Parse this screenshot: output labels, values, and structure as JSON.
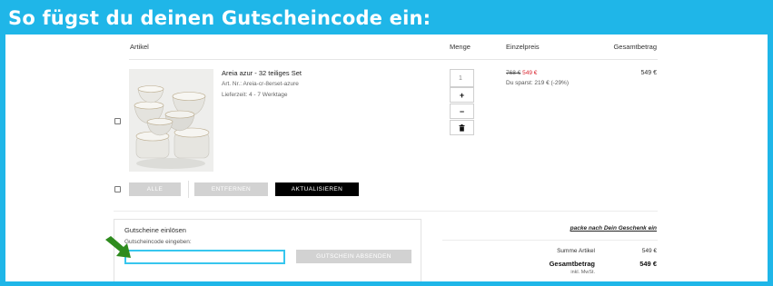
{
  "banner": {
    "title": "So fügst du deinen Gutscheincode ein:"
  },
  "table": {
    "headers": {
      "article": "Artikel",
      "quantity": "Menge",
      "unit_price": "Einzelpreis",
      "total": "Gesamtbetrag"
    }
  },
  "item": {
    "name": "Areia azur - 32 teiliges Set",
    "art_nr": "Art. Nr.: Areia-cr-8erset-azure",
    "delivery": "Lieferzeit: 4 - 7 Werktage",
    "old_price": "768 €",
    "new_price": "549 €",
    "savings": "Du sparst: 219 € (-29%)",
    "quantity": "1",
    "total": "549 €"
  },
  "controls": {
    "plus": "+",
    "minus": "−",
    "trash_icon": "trash-icon"
  },
  "actions": {
    "all": "ALLE",
    "remove": "ENTFERNEN",
    "update": "AKTUALISIEREN"
  },
  "coupon": {
    "title": "Gutscheine einlösen",
    "label": "Gutscheincode eingeben:",
    "value": "",
    "submit": "GUTSCHEIN ABSENDEN"
  },
  "gift_link": "packe nach Dein Geschenk ein",
  "summary": {
    "sum_label": "Summe Artikel",
    "sum_value": "549 €",
    "total_label": "Gesamtbetrag",
    "total_value": "549 €",
    "vat_note": "inkl. MwSt."
  },
  "colors": {
    "banner": "#1fb6e8",
    "old_price": "#d9232d",
    "input_focus": "#37c6ee",
    "arrow": "#2e8b1e"
  }
}
